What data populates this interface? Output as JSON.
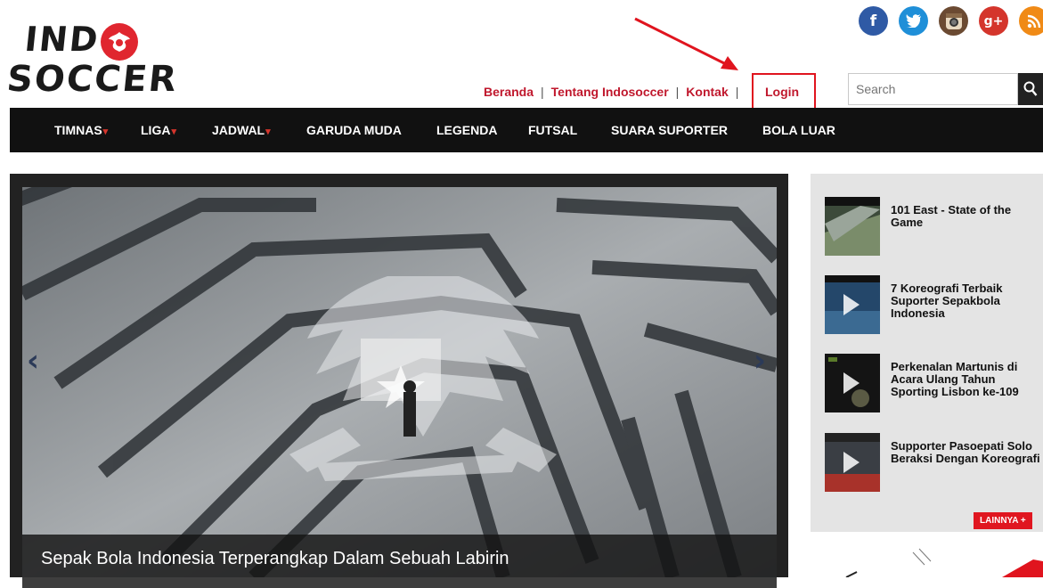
{
  "brand": {
    "logo_line1": "IND",
    "logo_line2": "SOCCER",
    "accent": "#e0262f"
  },
  "social": [
    {
      "name": "facebook-icon",
      "glyph": "f",
      "color": "#2f5aa5"
    },
    {
      "name": "twitter-icon",
      "glyph": "t",
      "color": "#1f8fd8"
    },
    {
      "name": "instagram-icon",
      "glyph": "◉",
      "color": "#6b4a32"
    },
    {
      "name": "google-plus-icon",
      "glyph": "g+",
      "color": "#d4352c"
    },
    {
      "name": "rss-icon",
      "glyph": "◜",
      "color": "#f08a16"
    }
  ],
  "toplinks": {
    "home": "Beranda",
    "about": "Tentang Indosoccer",
    "contact": "Kontak",
    "sep": "|",
    "login": "Login"
  },
  "search": {
    "placeholder": "Search",
    "icon": "search-icon"
  },
  "nav": {
    "items": [
      "TIMNAS",
      "LIGA",
      "JADWAL",
      "GARUDA MUDA",
      "LEGENDA",
      "FUTSAL",
      "SUARA SUPORTER",
      "BOLA LUAR"
    ],
    "dropdown_caret": "▾"
  },
  "hero": {
    "caption": "Sepak Bola Indonesia Terperangkap Dalam Sebuah Labirin",
    "prev": "‹",
    "next": "›"
  },
  "videos": [
    {
      "title": "101 East - State of the Game"
    },
    {
      "title": "7 Koreografi Terbaik Suporter Sepakbola Indonesia"
    },
    {
      "title": "Perkenalan Martunis di Acara Ulang Tahun Sporting Lisbon ke-109"
    },
    {
      "title": "Supporter Pasoepati Solo Beraksi Dengan Koreografi"
    }
  ],
  "more_label": "LAINNYA +"
}
